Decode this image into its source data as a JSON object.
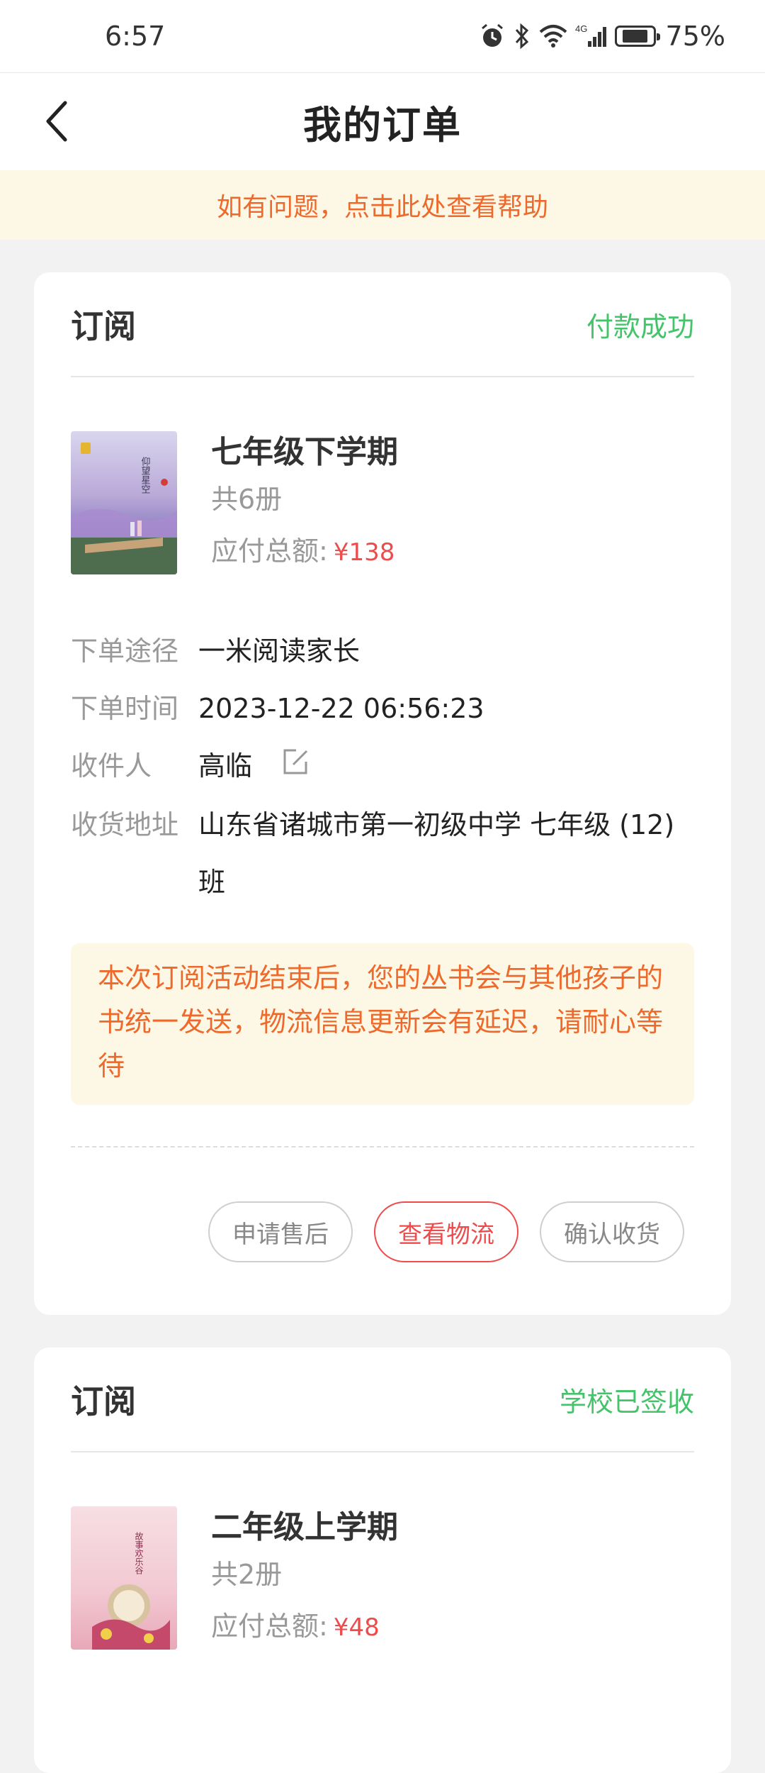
{
  "status_bar": {
    "time": "6:57",
    "battery": "75%",
    "battery_level": 0.75,
    "icons": [
      "alarm-icon",
      "bluetooth-icon",
      "wifi-icon",
      "4g-signal-icon",
      "battery-icon"
    ],
    "network_label": "4G"
  },
  "header": {
    "title": "我的订单"
  },
  "help_banner": {
    "text": "如有问题，点击此处查看帮助"
  },
  "colors": {
    "status_green": "#45c36a",
    "accent_orange": "#ee6a2c",
    "price_red": "#ee4c4c",
    "banner_bg": "#fdf8e6"
  },
  "orders": [
    {
      "type": "订阅",
      "status": "付款成功",
      "product": {
        "name": "七年级下学期",
        "count": "共6册",
        "amount_label": "应付总额:",
        "amount": "¥138",
        "cover_title": "仰望星空"
      },
      "details": [
        {
          "label": "下单途径",
          "value": "一米阅读家长"
        },
        {
          "label": "下单时间",
          "value": "2023-12-22 06:56:23"
        },
        {
          "label": "收件人",
          "value": "高临"
        },
        {
          "label": "收货地址",
          "value": "山东省诸城市第一初级中学 七年级 (12) 班"
        }
      ],
      "notice": "本次订阅活动结束后，您的丛书会与其他孩子的书统一发送，物流信息更新会有延迟，请耐心等待",
      "actions": [
        "申请售后",
        "查看物流",
        "确认收货"
      ]
    },
    {
      "type": "订阅",
      "status": "学校已签收",
      "product": {
        "name": "二年级上学期",
        "count": "共2册",
        "amount_label": "应付总额:",
        "amount": "¥48",
        "cover_title": "故事欢乐谷"
      }
    }
  ]
}
